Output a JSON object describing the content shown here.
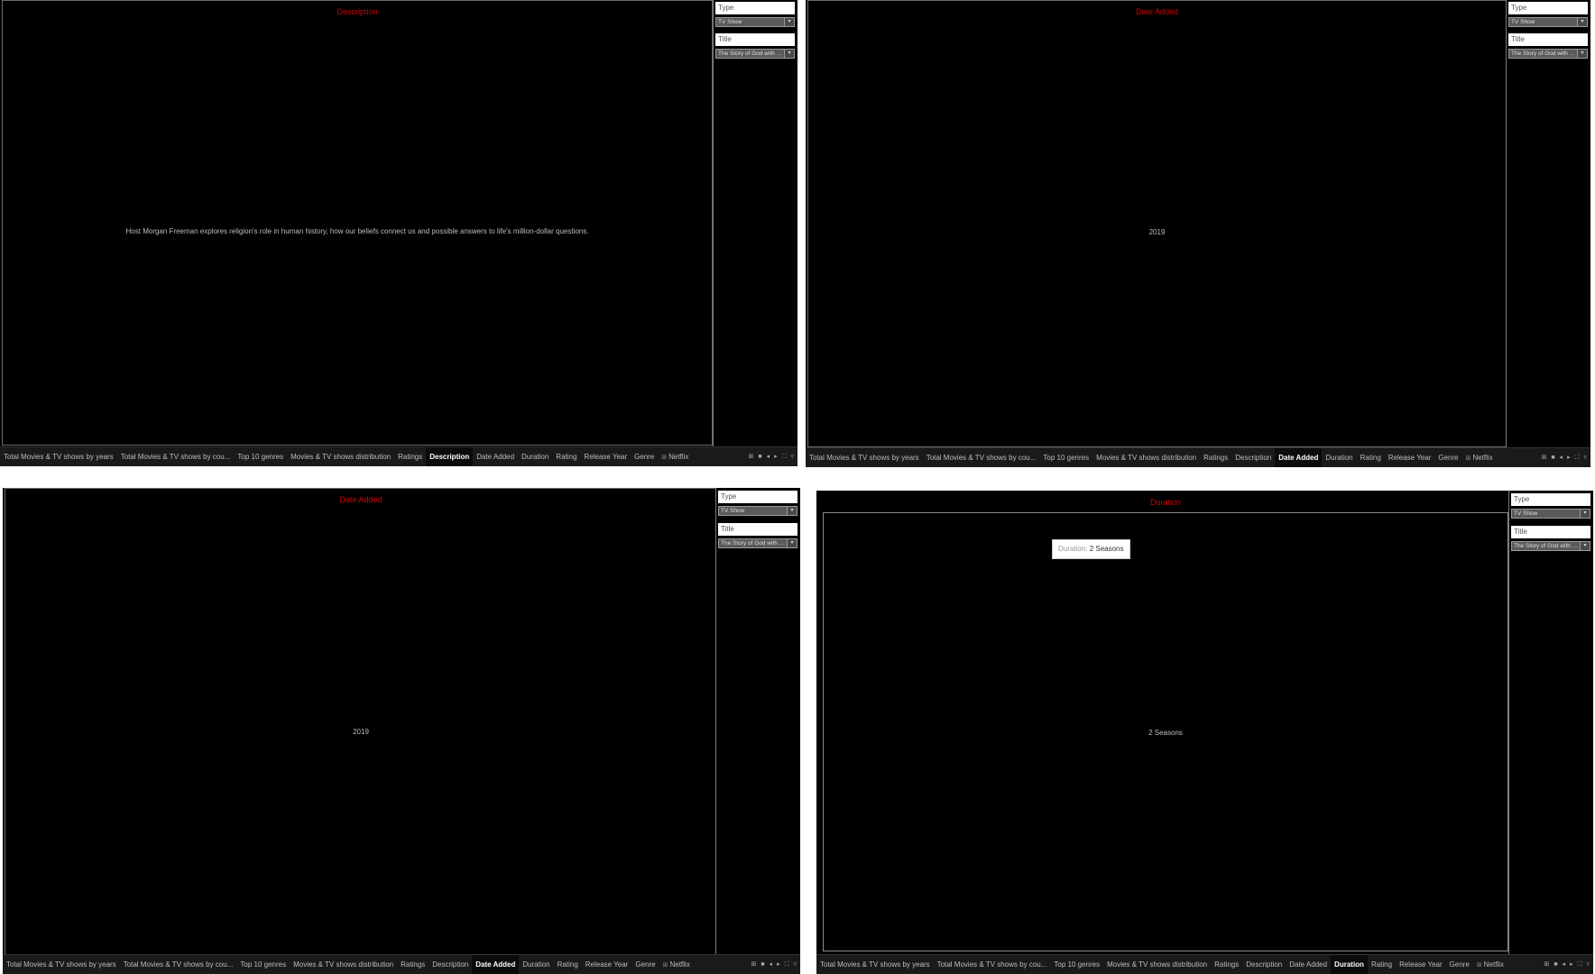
{
  "panels": [
    {
      "viz_title": "Description",
      "value": "Host Morgan Freeman explores religion's role in human history, how our beliefs connect us and possible answers to life's million-dollar questions.",
      "filters": [
        {
          "label": "Type",
          "selected": "TV Show"
        },
        {
          "label": "Title",
          "selected": "The Story of God with M..."
        }
      ],
      "active_tab": "Description"
    },
    {
      "viz_title": "Date Added",
      "value": "2019",
      "filters": [
        {
          "label": "Type",
          "selected": "TV Show"
        },
        {
          "label": "Title",
          "selected": "The Story of God with M..."
        }
      ],
      "active_tab": "Date Added"
    },
    {
      "viz_title": "Date Added",
      "value": "2019",
      "filters": [
        {
          "label": "Type",
          "selected": "TV Show"
        },
        {
          "label": "Title",
          "selected": "The Story of God with M..."
        }
      ],
      "active_tab": "Date Added"
    },
    {
      "viz_title": "Duration",
      "value": "2 Seasons",
      "tooltip": {
        "label": "Duration:",
        "value": "2 Seasons"
      },
      "filters": [
        {
          "label": "Type",
          "selected": "TV Show"
        },
        {
          "label": "Title",
          "selected": "The Story of God with M..."
        }
      ],
      "active_tab": "Duration"
    }
  ],
  "tabs": [
    "Total Movies & TV shows by years",
    "Total Movies & TV shows by cou...",
    "Top 10 genres",
    "Movies & TV shows distribution",
    "Ratings",
    "Description",
    "Date Added",
    "Duration",
    "Rating",
    "Release Year",
    "Genre",
    "Netflix"
  ],
  "icons": {
    "dashboard_tab": "dashboard-icon",
    "nav": [
      "grid-view-icon",
      "filmstrip-icon",
      "prev-icon",
      "next-icon",
      "fullscreen-icon",
      "comment-icon"
    ]
  }
}
